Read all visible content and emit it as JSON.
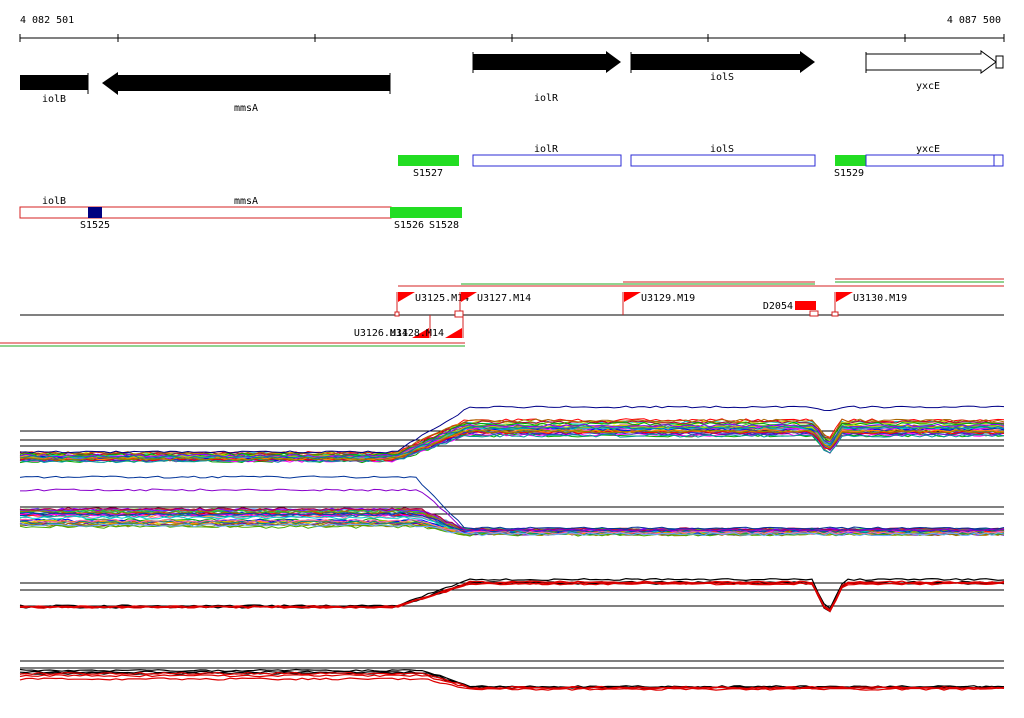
{
  "ruler": {
    "start_label": "4 082 501",
    "end_label": "4 087 500"
  },
  "genes": [
    {
      "name": "iolB"
    },
    {
      "name": "mmsA"
    },
    {
      "name": "iolR"
    },
    {
      "name": "iolS"
    },
    {
      "name": "yxcE"
    }
  ],
  "transcripts_upper": [
    {
      "name": "S1527"
    },
    {
      "name": "iolR"
    },
    {
      "name": "iolS"
    },
    {
      "name": "S1529"
    },
    {
      "name": "yxcE"
    }
  ],
  "transcripts_lower": [
    {
      "name": "iolB"
    },
    {
      "name": "mmsA"
    },
    {
      "name": "S1525"
    },
    {
      "name": "S1526"
    },
    {
      "name": "S1528"
    }
  ],
  "upshifts": [
    {
      "name": "U3125.M14"
    },
    {
      "name": "U3127.M14"
    },
    {
      "name": "U3129.M19"
    },
    {
      "name": "U3130.M19"
    },
    {
      "name": "U3126.M14"
    },
    {
      "name": "U3128.M14"
    }
  ],
  "downshift": {
    "name": "D2054"
  },
  "colors": {
    "gene": "#000000",
    "transcript_plus": "#2b2bd6",
    "transcript_minus": "#d42020",
    "segment": "#22dd22",
    "segment_dark": "#000080",
    "shift": "#ff0000",
    "track_line": "#000000"
  },
  "tracks": [
    {
      "id": "panel-a",
      "level": "rises after mmsA/iolR boundary, dip near yxcE"
    },
    {
      "id": "panel-b",
      "level": "falls after mmsA/iolR boundary"
    },
    {
      "id": "panel-c",
      "level": "rises after mmsA/iolR boundary, dip near yxcE"
    },
    {
      "id": "panel-d",
      "level": "falls after mmsA/iolR boundary"
    }
  ]
}
